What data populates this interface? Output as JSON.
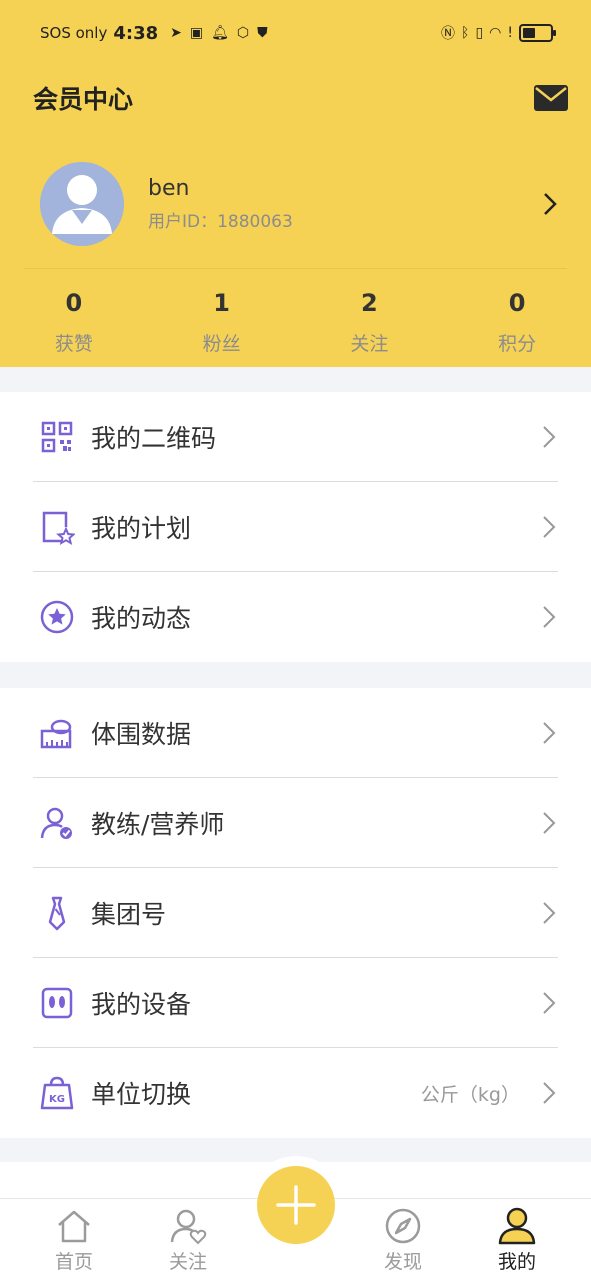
{
  "status_bar": {
    "carrier": "SOS only",
    "time": "4:38"
  },
  "header": {
    "title": "会员中心"
  },
  "profile": {
    "username": "ben",
    "user_id": "用户ID：1880063"
  },
  "stats": [
    {
      "value": "0",
      "label": "获赞"
    },
    {
      "value": "1",
      "label": "粉丝"
    },
    {
      "value": "2",
      "label": "关注"
    },
    {
      "value": "0",
      "label": "积分"
    }
  ],
  "menu_group_1": [
    {
      "label": "我的二维码",
      "icon": "qr-code-icon"
    },
    {
      "label": "我的计划",
      "icon": "plan-star-icon"
    },
    {
      "label": "我的动态",
      "icon": "star-circle-icon"
    }
  ],
  "menu_group_2": [
    {
      "label": "体围数据",
      "icon": "tape-measure-icon"
    },
    {
      "label": "教练/营养师",
      "icon": "coach-verified-icon"
    },
    {
      "label": "集团号",
      "icon": "tie-icon"
    },
    {
      "label": "我的设备",
      "icon": "scale-device-icon"
    },
    {
      "label": "单位切换",
      "icon": "kg-weight-icon",
      "value": "公斤（kg）"
    }
  ],
  "tabbar": [
    {
      "label": "首页",
      "icon": "home-icon"
    },
    {
      "label": "关注",
      "icon": "follow-heart-icon"
    },
    {
      "label": "发现",
      "icon": "compass-icon"
    },
    {
      "label": "我的",
      "icon": "profile-icon"
    }
  ],
  "colors": {
    "brand_yellow": "#f5d254",
    "icon_purple": "#7b61d6",
    "background": "#f2f4f7"
  }
}
